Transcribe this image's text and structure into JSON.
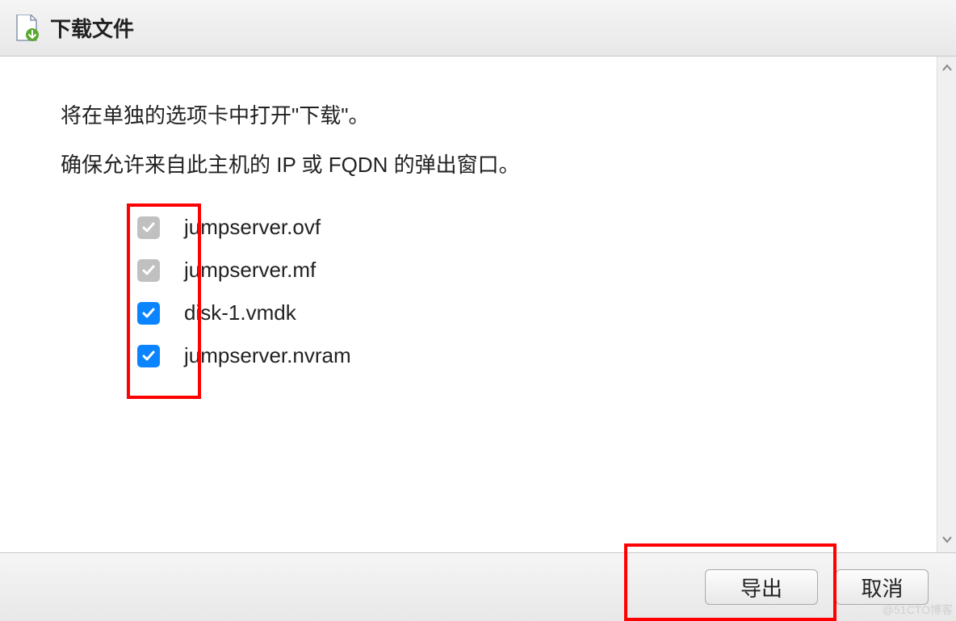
{
  "header": {
    "title": "下载文件"
  },
  "content": {
    "line1": "将在单独的选项卡中打开\"下载\"。",
    "line2": "确保允许来自此主机的 IP 或 FQDN 的弹出窗口。"
  },
  "files": [
    {
      "name": "jumpserver.ovf",
      "checked": true,
      "disabled": true
    },
    {
      "name": "jumpserver.mf",
      "checked": true,
      "disabled": true
    },
    {
      "name": "disk-1.vmdk",
      "checked": true,
      "disabled": false
    },
    {
      "name": "jumpserver.nvram",
      "checked": true,
      "disabled": false
    }
  ],
  "buttons": {
    "export": "导出",
    "cancel": "取消"
  },
  "watermark": "@51CTO博客"
}
